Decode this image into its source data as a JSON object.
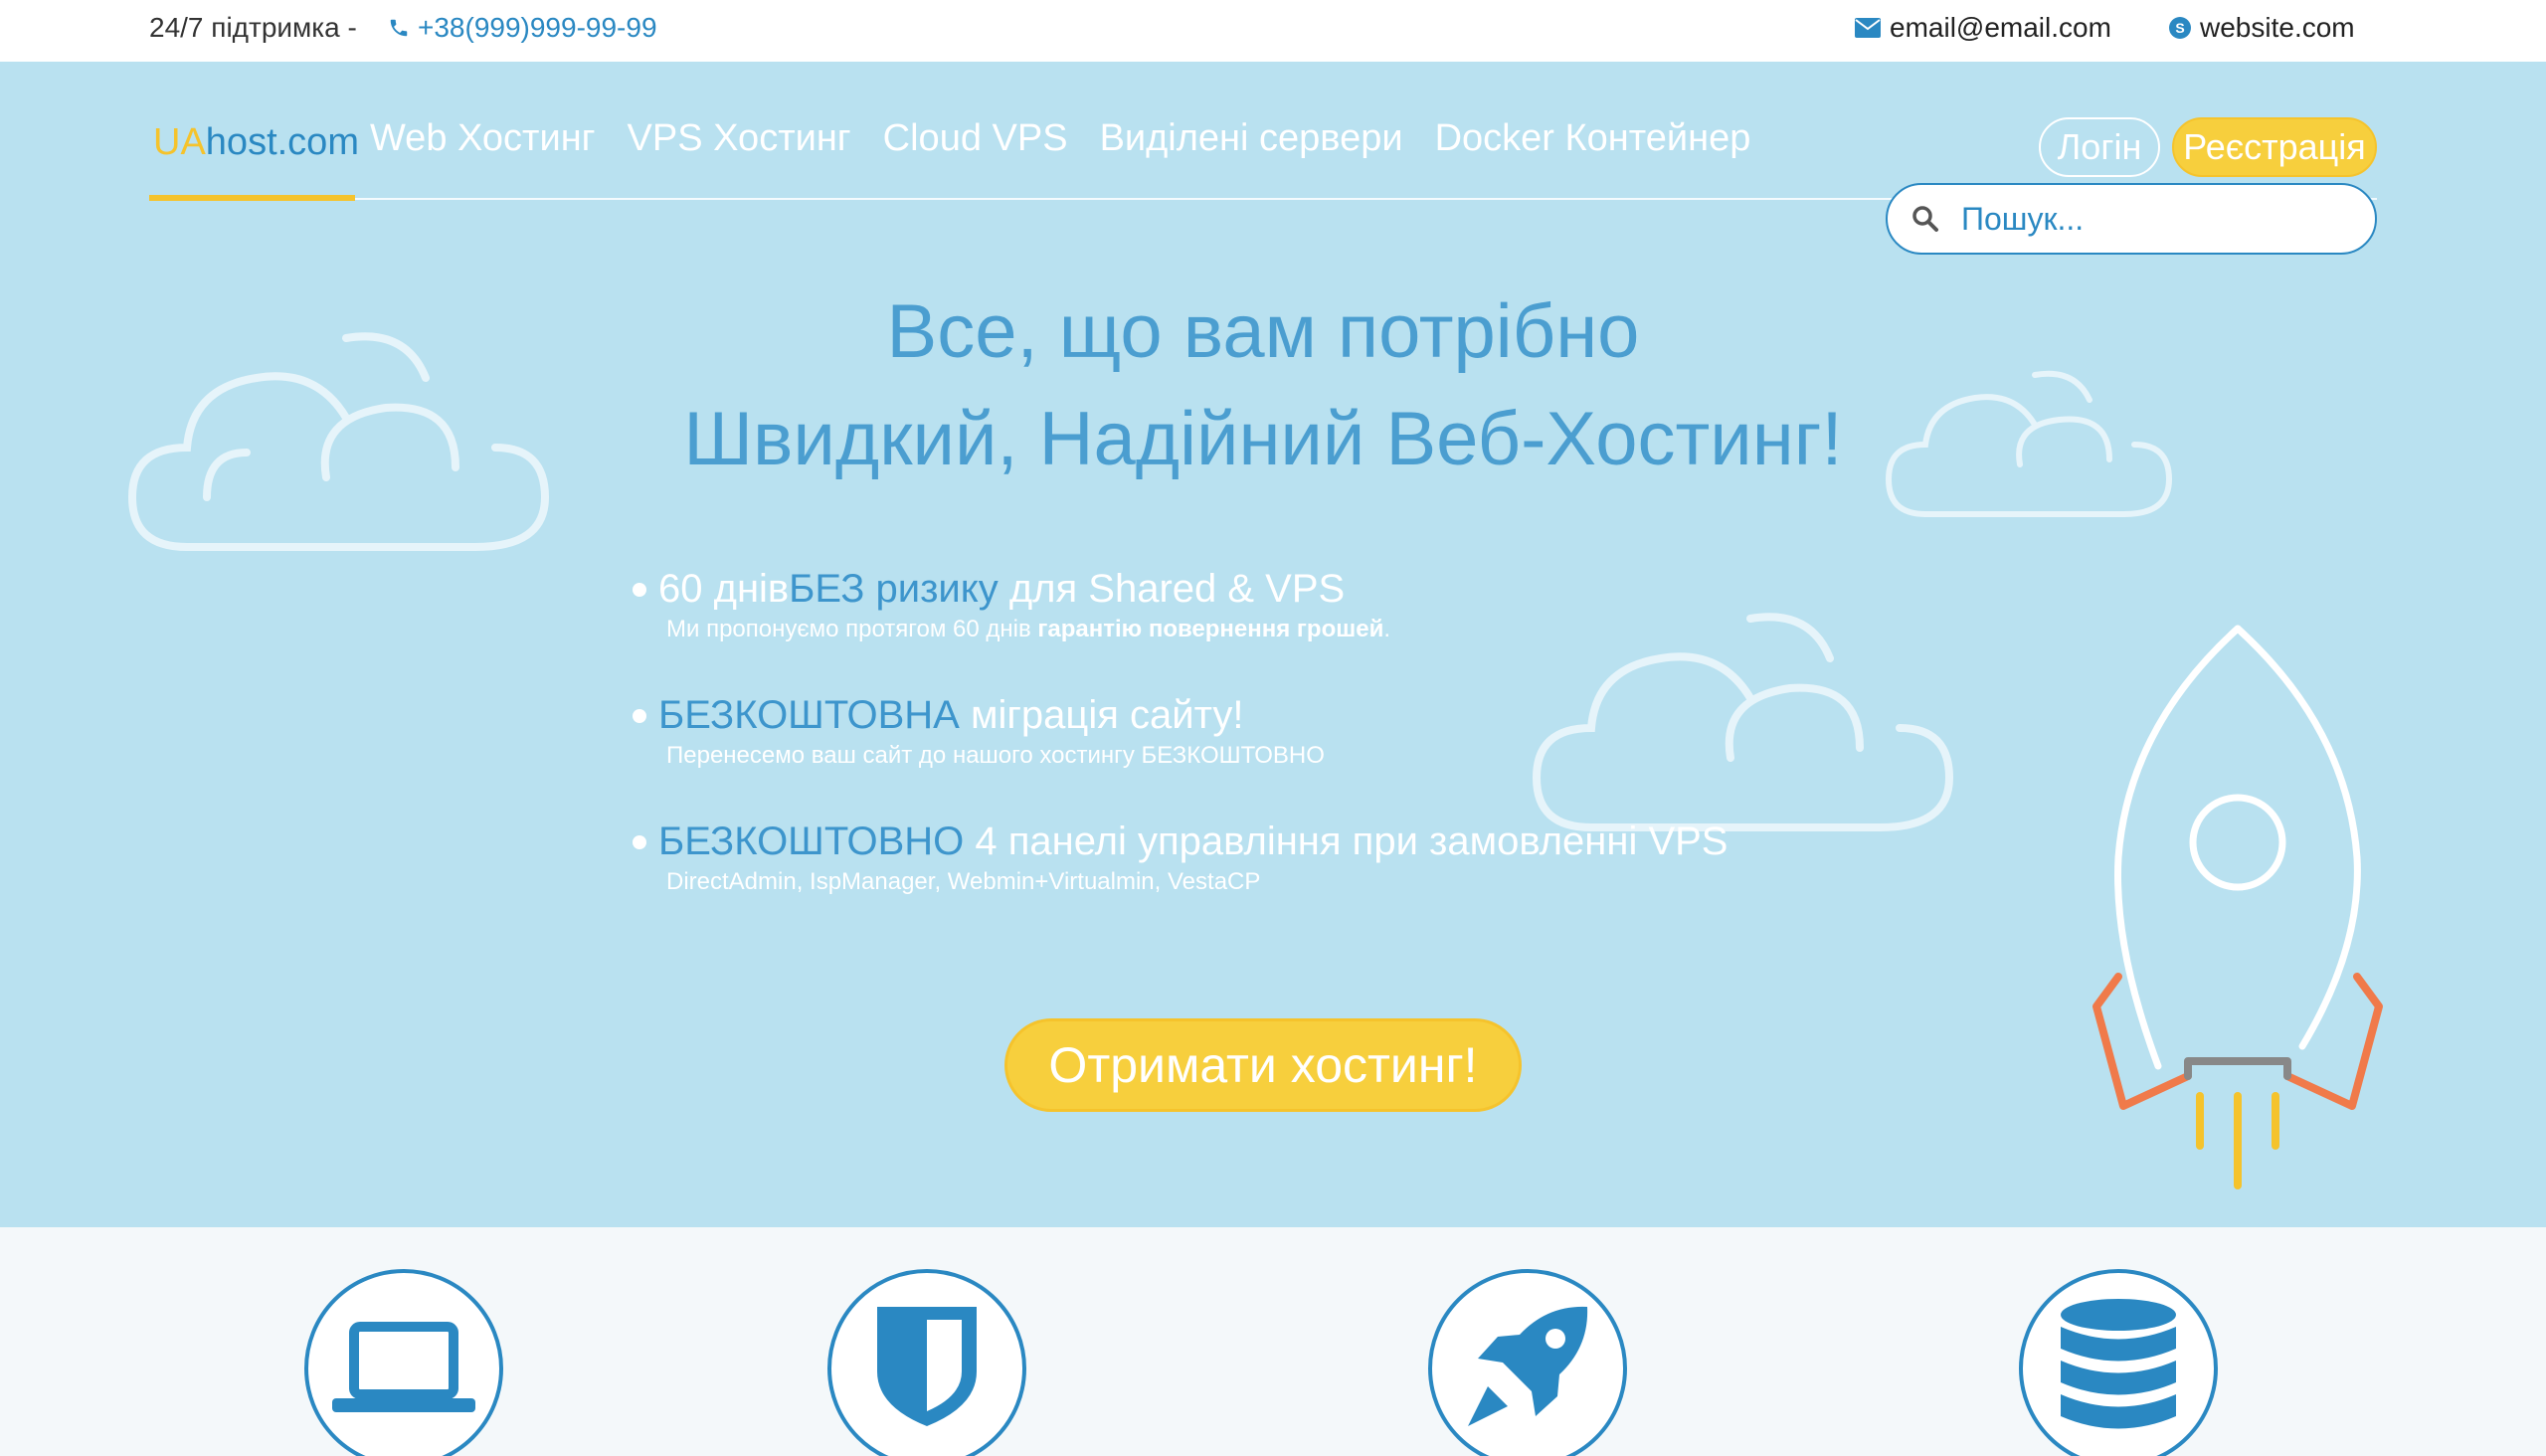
{
  "topbar": {
    "support": "24/7 підтримка -",
    "phone": "+38(999)999-99-99",
    "email": "email@email.com",
    "website": "website.com"
  },
  "nav": {
    "logo_prefix": "UA",
    "logo_rest": "host.com",
    "links": [
      "Web Хостинг",
      "VPS Хостинг",
      "Cloud VPS",
      "Виділені сервери",
      "Docker Контейнер"
    ],
    "login": "Логін",
    "register": "Реєстрація"
  },
  "search": {
    "placeholder": "Пошук..."
  },
  "hero": {
    "headline_1": "Все, що вам потрібно",
    "headline_2": "Швидкий, Надійний Веб-Хостинг!",
    "features": [
      {
        "pre": "60 днів ",
        "highlight": "БЕЗ ризику",
        "post": " для Shared & VPS",
        "sub_pre": "Ми пропонуємо протягом 60 днів ",
        "sub_bold": "гарантію повернення грошей",
        "sub_post": "."
      },
      {
        "pre": "",
        "highlight": "БЕЗКОШТОВНА",
        "post": " міграція сайту!",
        "sub_pre": "Перенесемо ваш сайт до нашого хостингу БЕЗКОШТОВНО",
        "sub_bold": "",
        "sub_post": ""
      },
      {
        "pre": "",
        "highlight": "БЕЗКОШТОВНО",
        "post": " 4 панелі управління при замовленні VPS",
        "sub_pre": "DirectAdmin, IspManager, Webmin+Virtualmin, VestaCP",
        "sub_bold": "",
        "sub_post": ""
      }
    ],
    "cta": "Отримати хостинг!"
  },
  "features_icons": [
    "laptop-icon",
    "shield-icon",
    "rocket-icon",
    "database-icon"
  ],
  "colors": {
    "accent": "#2a88c2",
    "yellow": "#f5c32c",
    "hero_bg": "#b9e1f0",
    "rocket_orange": "#f07a4a"
  }
}
